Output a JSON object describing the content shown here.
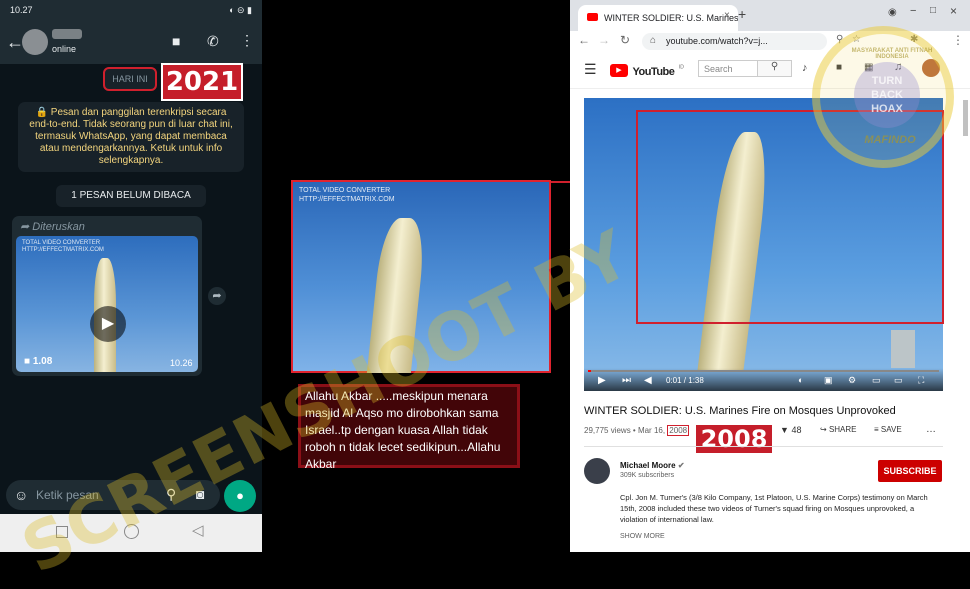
{
  "whatsapp": {
    "status_time": "10.27",
    "status_battery": "◐ ⊝ ▮",
    "contact_status": "online",
    "date_chip": "HARI INI",
    "year_tag": "2021",
    "encryption_notice": "🔒 Pesan dan panggilan terenkripsi secara end-to-end. Tidak seorang pun di luar chat ini, termasuk WhatsApp, yang dapat membaca atau mendengarkannya. Ketuk untuk info selengkapnya.",
    "unread_chip": "1 PESAN BELUM DIBACA",
    "forwarded_label": "Diteruskan",
    "video_size": "1.08",
    "video_time": "10.26",
    "video_watermark_line1": "TOTAL VIDEO CONVERTER",
    "video_watermark_line2": "HTTP://EFFECTMATRIX.COM",
    "message_placeholder": "Ketik pesan"
  },
  "middle": {
    "watermark_line1": "TOTAL VIDEO CONVERTER",
    "watermark_line2": "HTTP://EFFECTMATRIX.COM",
    "caption": "Allahu Akbar .....meskipun menara masjid Al Aqso mo dirobohkan sama Israel..tp dengan kuasa Allah tidak roboh n tidak lecet sedikipun...Allahu Akbar"
  },
  "browser": {
    "tab_title": "WINTER SOLDIER: U.S. Marines F",
    "url": "youtube.com/watch?v=j...",
    "youtube": {
      "logo_text": "YouTube",
      "logo_sup": "ID",
      "search_placeholder": "Search",
      "video_time": "0:01 / 1:38",
      "video_title": "WINTER SOLDIER: U.S. Marines Fire on Mosques Unprovoked",
      "views": "29,775 views • Mar 16,",
      "year": "2008",
      "year_tag": "2008",
      "dislikes": "48",
      "share_label": "SHARE",
      "save_label": "SAVE",
      "channel_name": "Michael Moore",
      "subscribers": "309K subscribers",
      "subscribe_label": "SUBSCRIBE",
      "description": "Cpl. Jon M. Turner's (3/8 Kilo Company, 1st Platoon, U.S. Marine Corps) testimony on March 15th, 2008 included these two videos of Turner's squad firing on Mosques unprovoked, a violation of international law.",
      "show_more": "SHOW MORE"
    }
  },
  "watermark": {
    "main_text": "SCREENSHOOT BY",
    "seal_top": "MASYARAKAT ANTI FITNAH INDONESIA",
    "seal_center1": "TURN",
    "seal_center2": "BACK",
    "seal_center3": "HOAX",
    "seal_bottom": "MAFINDO"
  },
  "colors": {
    "highlight_red": "#d0202d",
    "youtube_red": "#ff0000",
    "whatsapp_green": "#00a884"
  }
}
